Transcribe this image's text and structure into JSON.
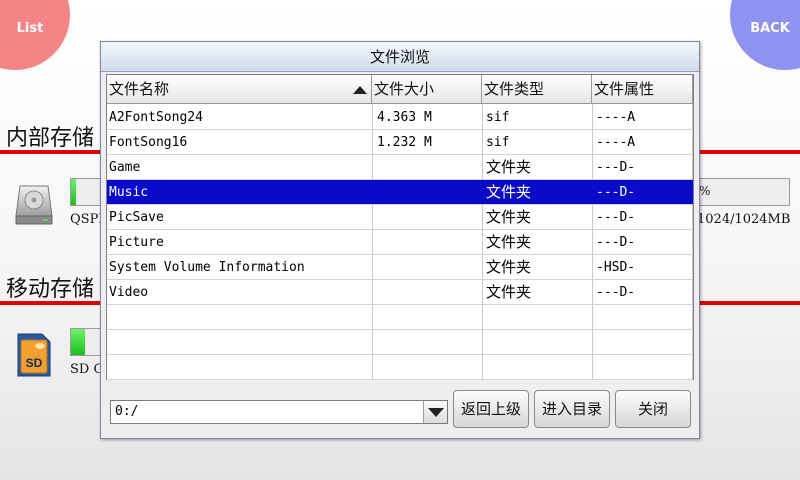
{
  "corner": {
    "list_label": "List",
    "back_label": "BACK"
  },
  "internal": {
    "title": "内部存储",
    "drive_label": "QSPI",
    "size_text": "1024/1024MB",
    "percent_text": "%",
    "fill_fraction_left": 0.15
  },
  "mobile": {
    "title": "移动存储",
    "drive_label": "SD C",
    "fill_fraction_left": 0.45
  },
  "dialog": {
    "title": "文件浏览",
    "columns": [
      "文件名称",
      "文件大小",
      "文件类型",
      "文件属性"
    ],
    "rows": [
      {
        "name": "A2FontSong24",
        "size": "4.363 M",
        "type": "sif",
        "attr": "----A",
        "selected": false
      },
      {
        "name": "FontSong16",
        "size": "1.232 M",
        "type": "sif",
        "attr": "----A",
        "selected": false
      },
      {
        "name": "Game",
        "size": "",
        "type": "文件夹",
        "attr": "---D-",
        "selected": false
      },
      {
        "name": "Music",
        "size": "",
        "type": "文件夹",
        "attr": "---D-",
        "selected": true
      },
      {
        "name": "PicSave",
        "size": "",
        "type": "文件夹",
        "attr": "---D-",
        "selected": false
      },
      {
        "name": "Picture",
        "size": "",
        "type": "文件夹",
        "attr": "---D-",
        "selected": false
      },
      {
        "name": "System Volume Information",
        "size": "",
        "type": "文件夹",
        "attr": "-HSD-",
        "selected": false
      },
      {
        "name": "Video",
        "size": "",
        "type": "文件夹",
        "attr": "---D-",
        "selected": false
      }
    ],
    "empty_rows": 3,
    "path_value": "0:/",
    "buttons": {
      "up": "返回上级",
      "enter": "进入目录",
      "close": "关闭"
    }
  },
  "colors": {
    "selection": "#0a0ac8",
    "accent_red": "#e00000",
    "list_button": "#f58484",
    "back_button": "#8f92f0"
  },
  "icons": {
    "internal_drive": "hard-drive-icon",
    "mobile_drive": "sd-card-icon",
    "sort": "sort-ascending-icon",
    "combo": "chevron-down-icon"
  }
}
